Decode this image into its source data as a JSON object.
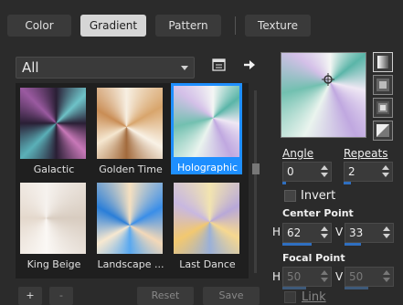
{
  "tabs": [
    {
      "label": "Color",
      "active": false
    },
    {
      "label": "Gradient",
      "active": true
    },
    {
      "label": "Pattern",
      "active": false
    },
    {
      "label": "Texture",
      "active": false
    }
  ],
  "category": {
    "selected": "All"
  },
  "gradients": [
    {
      "label": "Galactic",
      "selected": false
    },
    {
      "label": "Golden Time",
      "selected": false
    },
    {
      "label": "Holographic",
      "selected": true
    },
    {
      "label": "King Beige",
      "selected": false
    },
    {
      "label": "Landscape ...",
      "selected": false
    },
    {
      "label": "Last Dance",
      "selected": false
    }
  ],
  "bottom_buttons": {
    "add": "+",
    "remove": "-",
    "reset": "Reset",
    "save": "Save"
  },
  "angle": {
    "label": "Angle",
    "value": "0"
  },
  "repeats": {
    "label": "Repeats",
    "value": "2"
  },
  "invert": {
    "label": "Invert",
    "checked": false
  },
  "center_point": {
    "label": "Center Point",
    "h_label": "H",
    "h_value": "62",
    "v_label": "V",
    "v_value": "33"
  },
  "focal_point": {
    "label": "Focal Point",
    "h_label": "H",
    "h_value": "50",
    "v_label": "V",
    "v_value": "50",
    "enabled": false
  },
  "link": {
    "label": "Link",
    "checked": false
  },
  "colors": {
    "accent": "#1e8fff",
    "slider": "#2f6fc0"
  },
  "icons": {
    "folder": "folder-icon",
    "arrow": "arrow-right-icon",
    "styles": [
      "style-linear-icon",
      "style-rectangular-icon",
      "style-sunburst-icon",
      "style-radial-icon"
    ]
  }
}
